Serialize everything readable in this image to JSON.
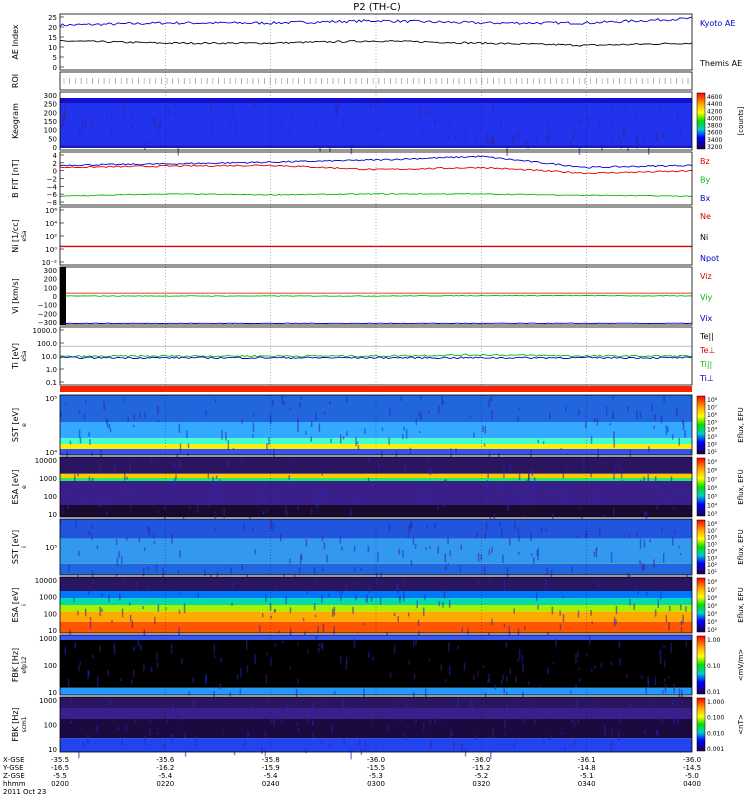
{
  "figure_title": "P2 (TH-C)",
  "time_axis": {
    "ticks": [
      "0200",
      "0220",
      "0240",
      "0300",
      "0320",
      "0340",
      "0400"
    ],
    "start": "0200",
    "end": "0400",
    "row_labels": [
      "X-GSE",
      "Y-GSE",
      "Z-GSE",
      "hhmm",
      "2011 Oct 23"
    ],
    "x_gse": [
      "-35.5",
      "-35.6",
      "-35.8",
      "-36.0",
      "-36.0",
      "-36.1",
      "-36.0"
    ],
    "y_gse": [
      "-16.5",
      "-16.2",
      "-15.9",
      "-15.5",
      "-15.2",
      "-14.8",
      "-14.5"
    ],
    "z_gse": [
      "-5.5",
      "-5.4",
      "-5.4",
      "-5.3",
      "-5.2",
      "-5.1",
      "-5.0"
    ]
  },
  "colors": {
    "red": "#dd0000",
    "green": "#00bb00",
    "blue": "#0000cc",
    "black": "#000000"
  },
  "panels": [
    {
      "id": "ae",
      "ylabel": "AE Index",
      "yticks": [
        "25",
        "20",
        "15",
        "10",
        "5",
        "0"
      ],
      "legend": [
        {
          "text": "Kyoto AE",
          "color": "#0000cc"
        },
        {
          "text": "Themis AE",
          "color": "#000000"
        }
      ]
    },
    {
      "id": "roi",
      "ylabel": "ROI"
    },
    {
      "id": "keogram",
      "ylabel": "Keogram",
      "yticks": [
        "300",
        "250",
        "200",
        "150",
        "100",
        "50",
        "0"
      ],
      "colorbar": {
        "label": "[counts]",
        "ticks": [
          "4600",
          "4400",
          "4200",
          "4000",
          "3800",
          "3600",
          "3400",
          "3200"
        ]
      }
    },
    {
      "id": "bfit",
      "ylabel": "B FIT [nT]",
      "yticks": [
        "4",
        "2",
        "0",
        "−2",
        "−4",
        "−6",
        "−8"
      ],
      "legend": [
        {
          "text": "Bz",
          "color": "#dd0000"
        },
        {
          "text": "By",
          "color": "#00bb00"
        },
        {
          "text": "Bx",
          "color": "#0000cc"
        }
      ]
    },
    {
      "id": "ni",
      "ylabel": "Ni [1/cc]",
      "sublabel": "eSa",
      "yticks": [
        "10⁶",
        "10⁴",
        "10²",
        "10⁰",
        "10⁻²"
      ],
      "legend": [
        {
          "text": "Ne",
          "color": "#dd0000"
        },
        {
          "text": "Ni",
          "color": "#000000"
        },
        {
          "text": "Npot",
          "color": "#0000cc"
        }
      ]
    },
    {
      "id": "vi",
      "ylabel": "Vi [km/s]",
      "yticks": [
        "300",
        "200",
        "100",
        "0",
        "−100",
        "−200",
        "−300"
      ],
      "legend": [
        {
          "text": "Viz",
          "color": "#dd0000"
        },
        {
          "text": "Viy",
          "color": "#00bb00"
        },
        {
          "text": "Vix",
          "color": "#0000cc"
        }
      ]
    },
    {
      "id": "ti",
      "ylabel": "Ti [eV]",
      "sublabel": "eSa",
      "yticks": [
        "1000.0",
        "100.0",
        "10.0",
        "1.0",
        "0.1"
      ],
      "legend": [
        {
          "text": "Te||",
          "color": "#000000"
        },
        {
          "text": "Te⊥",
          "color": "#dd0000"
        },
        {
          "text": "Ti||",
          "color": "#00bb00"
        },
        {
          "text": "Ti⊥",
          "color": "#0000cc"
        }
      ]
    },
    {
      "id": "sst_e",
      "ylabel": "SST [eV]",
      "sublabel": "e",
      "yticks": [
        "10⁵",
        "10⁴"
      ],
      "colorbar": {
        "label": "Eflux, EFU",
        "ticks": [
          "10⁸",
          "10⁷",
          "10⁶",
          "10⁵",
          "10⁴",
          "10³",
          "10²",
          "10¹"
        ]
      }
    },
    {
      "id": "esa_e",
      "ylabel": "ESA [eV]",
      "sublabel": "e",
      "yticks": [
        "10000",
        "1000",
        "100",
        "10"
      ],
      "colorbar": {
        "label": "Eflux, EFU",
        "ticks": [
          "10⁹",
          "10⁸",
          "10⁷",
          "10⁶",
          "10⁵",
          "10⁴",
          "10³"
        ]
      }
    },
    {
      "id": "sst_i",
      "ylabel": "SST [eV]",
      "sublabel": "i",
      "yticks": [
        "10⁵"
      ],
      "colorbar": {
        "label": "Eflux, EFU",
        "ticks": [
          "10⁸",
          "10⁷",
          "10⁶",
          "10⁵",
          "10⁴",
          "10³",
          "10²",
          "10¹"
        ]
      }
    },
    {
      "id": "esa_i",
      "ylabel": "ESA [eV]",
      "sublabel": "i",
      "yticks": [
        "10000",
        "1000",
        "100",
        "10"
      ],
      "colorbar": {
        "label": "Eflux, EFU",
        "ticks": [
          "10⁸",
          "10⁷",
          "10⁶",
          "10⁵",
          "10⁴",
          "10³",
          "10²"
        ]
      }
    },
    {
      "id": "fbk1",
      "ylabel": "FBK [Hz]",
      "sublabel": "efp12",
      "yticks": [
        "1000",
        "100",
        "10"
      ],
      "colorbar": {
        "label": "<mV/m>",
        "ticks": [
          "1.00",
          "0.10",
          "0.01"
        ]
      }
    },
    {
      "id": "fbk2",
      "ylabel": "FBK [Hz]",
      "sublabel": "scm1",
      "yticks": [
        "1000",
        "100",
        "10"
      ],
      "colorbar": {
        "label": "<nT>",
        "ticks": [
          "1.000",
          "0.100",
          "0.010",
          "0.001"
        ]
      }
    }
  ],
  "chart_data": {
    "type": "line",
    "title": "P2 (TH-C)",
    "x_range": [
      "02:00",
      "04:00"
    ],
    "series": [
      {
        "name": "Kyoto AE",
        "x": [
          "02:00",
          "02:20",
          "02:40",
          "03:00",
          "03:20",
          "03:40",
          "04:00"
        ],
        "values": [
          20,
          21,
          21,
          22,
          21,
          21,
          23
        ]
      },
      {
        "name": "Themis AE",
        "x": [
          "02:00",
          "02:20",
          "02:40",
          "03:00",
          "03:20",
          "03:40",
          "04:00"
        ],
        "values": [
          13,
          12,
          12,
          13,
          12,
          11,
          12
        ]
      },
      {
        "name": "Bz",
        "x": [
          "02:00",
          "02:20",
          "02:40",
          "03:00",
          "03:20",
          "03:40",
          "04:00"
        ],
        "values": [
          0.5,
          0.8,
          1,
          0,
          0.5,
          -0.8,
          -0.3
        ]
      },
      {
        "name": "By",
        "x": [
          "02:00",
          "02:20",
          "02:40",
          "03:00",
          "03:20",
          "03:40",
          "04:00"
        ],
        "values": [
          -6,
          -5.5,
          -5.7,
          -5.5,
          -5.5,
          -5.8,
          -6
        ]
      },
      {
        "name": "Bx",
        "x": [
          "02:00",
          "02:20",
          "02:40",
          "03:00",
          "03:20",
          "03:40",
          "04:00"
        ],
        "values": [
          1,
          1.3,
          1.7,
          2.2,
          3,
          0.5,
          1
        ]
      }
    ],
    "ae_ylim": [
      0,
      25
    ],
    "b_ylim": [
      -8,
      4
    ],
    "v_ylim": [
      -350,
      350
    ]
  }
}
